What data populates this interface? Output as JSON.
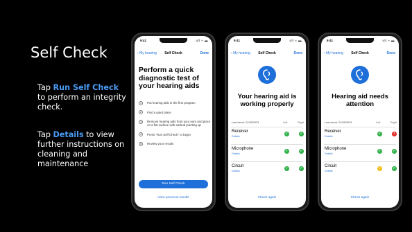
{
  "slide": {
    "title": "Self Check",
    "desc1_pre": "Tap ",
    "desc1_hl": "Run Self Check",
    "desc1_post": " to perform an integrity check.",
    "desc2_pre": "Tap ",
    "desc2_hl": "Details",
    "desc2_post": " to view further instructions on cleaning and maintenance"
  },
  "colors": {
    "accent": "#1e6fd9",
    "highlight": "#4a9bf5",
    "ok": "#34b24c",
    "error": "#e2302a",
    "warning": "#f2c01e"
  },
  "phone_common": {
    "time": "9:41",
    "signal": "ull ≈ ▬",
    "back": "My hearing",
    "nav_title": "Self Check",
    "done": "Done"
  },
  "phone1": {
    "heading": "Perform a quick diagnostic test of your hearing aids",
    "steps": [
      {
        "num": "1",
        "text": "Put hearing aids in the first program"
      },
      {
        "num": "2",
        "text": "Find a quiet place"
      },
      {
        "num": "3",
        "text": "Remove hearing aids from your ears and place on a flat surface with earbud pointing up"
      },
      {
        "num": "4",
        "text": "Press \"Run Self Check\" to begin"
      },
      {
        "num": "5",
        "text": "Review your results"
      }
    ],
    "run_button": "Run Self Check",
    "bottom_link": "View previous results"
  },
  "result_common": {
    "last_check": "Last check: 01/05/2023",
    "col_left": "Left",
    "col_right": "Right",
    "details": "Details",
    "rows": [
      "Receiver",
      "Microphone",
      "Circuit"
    ],
    "bottom_link": "Check again"
  },
  "phone2": {
    "heading": "Your hearing aid is working properly",
    "status": [
      [
        "ok",
        "ok"
      ],
      [
        "ok",
        "ok"
      ],
      [
        "ok",
        "ok"
      ]
    ]
  },
  "phone3": {
    "heading": "Hearing aid needs attention",
    "status": [
      [
        "ok",
        "error"
      ],
      [
        "ok",
        "ok"
      ],
      [
        "warning",
        "ok"
      ]
    ]
  }
}
